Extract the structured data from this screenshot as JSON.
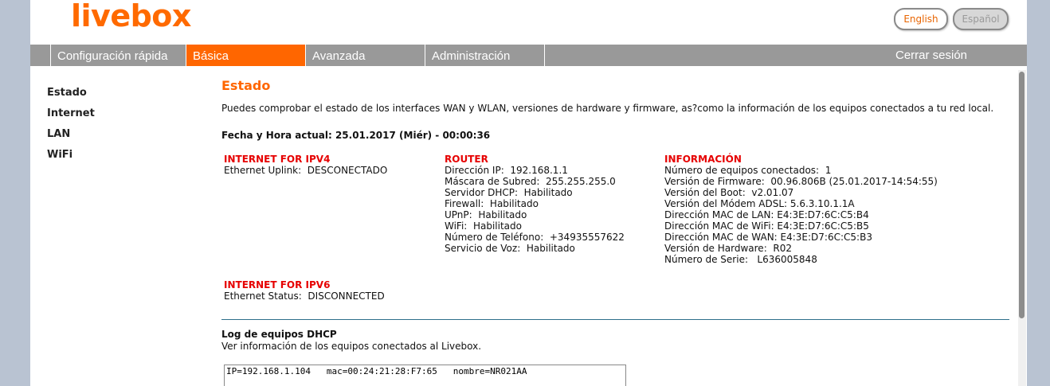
{
  "header": {
    "logo": "livebox",
    "lang_english": "English",
    "lang_spanish": "Español"
  },
  "nav": {
    "quick": "Configuración rápida",
    "basic": "Básica",
    "advanced": "Avanzada",
    "admin": "Administración",
    "logout": "Cerrar sesión"
  },
  "sidebar": {
    "items": [
      {
        "label": "Estado"
      },
      {
        "label": "Internet"
      },
      {
        "label": "LAN"
      },
      {
        "label": "WiFi"
      }
    ]
  },
  "main": {
    "title": "Estado",
    "intro": "Puedes comprobar el estado de los interfaces WAN y WLAN, versiones de hardware y firmware, as?como la información de los equipos conectados a tu red local.",
    "datetime": "Fecha y Hora actual: 25.01.2017 (Miér) - 00:00:36",
    "ipv4": {
      "title": "INTERNET FOR IPV4",
      "rows": [
        "Ethernet Uplink:  DESCONECTADO"
      ]
    },
    "router": {
      "title": "ROUTER",
      "rows": [
        "Dirección IP:  192.168.1.1",
        "Máscara de Subred:  255.255.255.0",
        "Servidor DHCP:  Habilitado",
        "Firewall:  Habilitado",
        "UPnP:  Habilitado",
        "WiFi:  Habilitado",
        "Número de Teléfono:  +34935557622",
        "Servicio de Voz:  Habilitado"
      ]
    },
    "info": {
      "title": "INFORMACIÓN",
      "rows": [
        "Número de equipos conectados:  1",
        "Versión de Firmware:  00.96.806B (25.01.2017-14:54:55)",
        "Versión del Boot:  v2.01.07",
        "Versión del Módem ADSL: 5.6.3.10.1.1A",
        "Dirección MAC de LAN: E4:3E:D7:6C:C5:B4",
        "Dirección MAC de WiFi: E4:3E:D7:6C:C5:B5",
        "Dirección MAC de WAN: E4:3E:D7:6C:C5:B3",
        "Versión de Hardware:  R02",
        "Número de Serie:   L636005848"
      ]
    },
    "ipv6": {
      "title": "INTERNET FOR IPV6",
      "rows": [
        "Ethernet Status:  DISCONNECTED"
      ]
    },
    "log": {
      "title": "Log de equipos DHCP",
      "description": "Ver información de los equipos conectados al Livebox.",
      "entries": "IP=192.168.1.104   mac=00:24:21:28:F7:65   nombre=NR021AA"
    }
  },
  "colors": {
    "accent": "#ff6600",
    "nav_bg": "#999999",
    "section_title": "#e60000",
    "page_bg": "#b9c3d2"
  }
}
